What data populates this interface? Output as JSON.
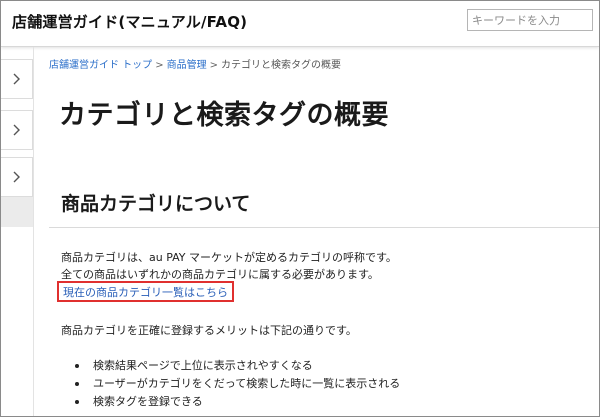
{
  "header": {
    "site_title": "店舗運営ガイド(マニュアル/FAQ)",
    "search_placeholder": "キーワードを入力"
  },
  "sidebar": {
    "toggles": [
      "chevron-right-icon",
      "chevron-right-icon",
      "chevron-right-icon"
    ]
  },
  "breadcrumb": {
    "home": "店舗運営ガイド トップ",
    "separator": ">",
    "category": "商品管理",
    "current": "カテゴリと検索タグの概要"
  },
  "main": {
    "page_title": "カテゴリと検索タグの概要",
    "section_heading": "商品カテゴリについて",
    "intro_line1": "商品カテゴリは、au PAY マーケットが定めるカテゴリの呼称です。",
    "intro_line2": "全ての商品はいずれかの商品カテゴリに属する必要があります。",
    "category_list_link": "現在の商品カテゴリ一覧はこちら",
    "merits_intro": "商品カテゴリを正確に登録するメリットは下記の通りです。",
    "merits": [
      "検索結果ページで上位に表示されやすくなる",
      "ユーザーがカテゴリをくだって検索した時に一覧に表示される",
      "検索タグを登録できる"
    ]
  },
  "colors": {
    "link": "#2a6ec9",
    "highlight_border": "#e0302f"
  }
}
